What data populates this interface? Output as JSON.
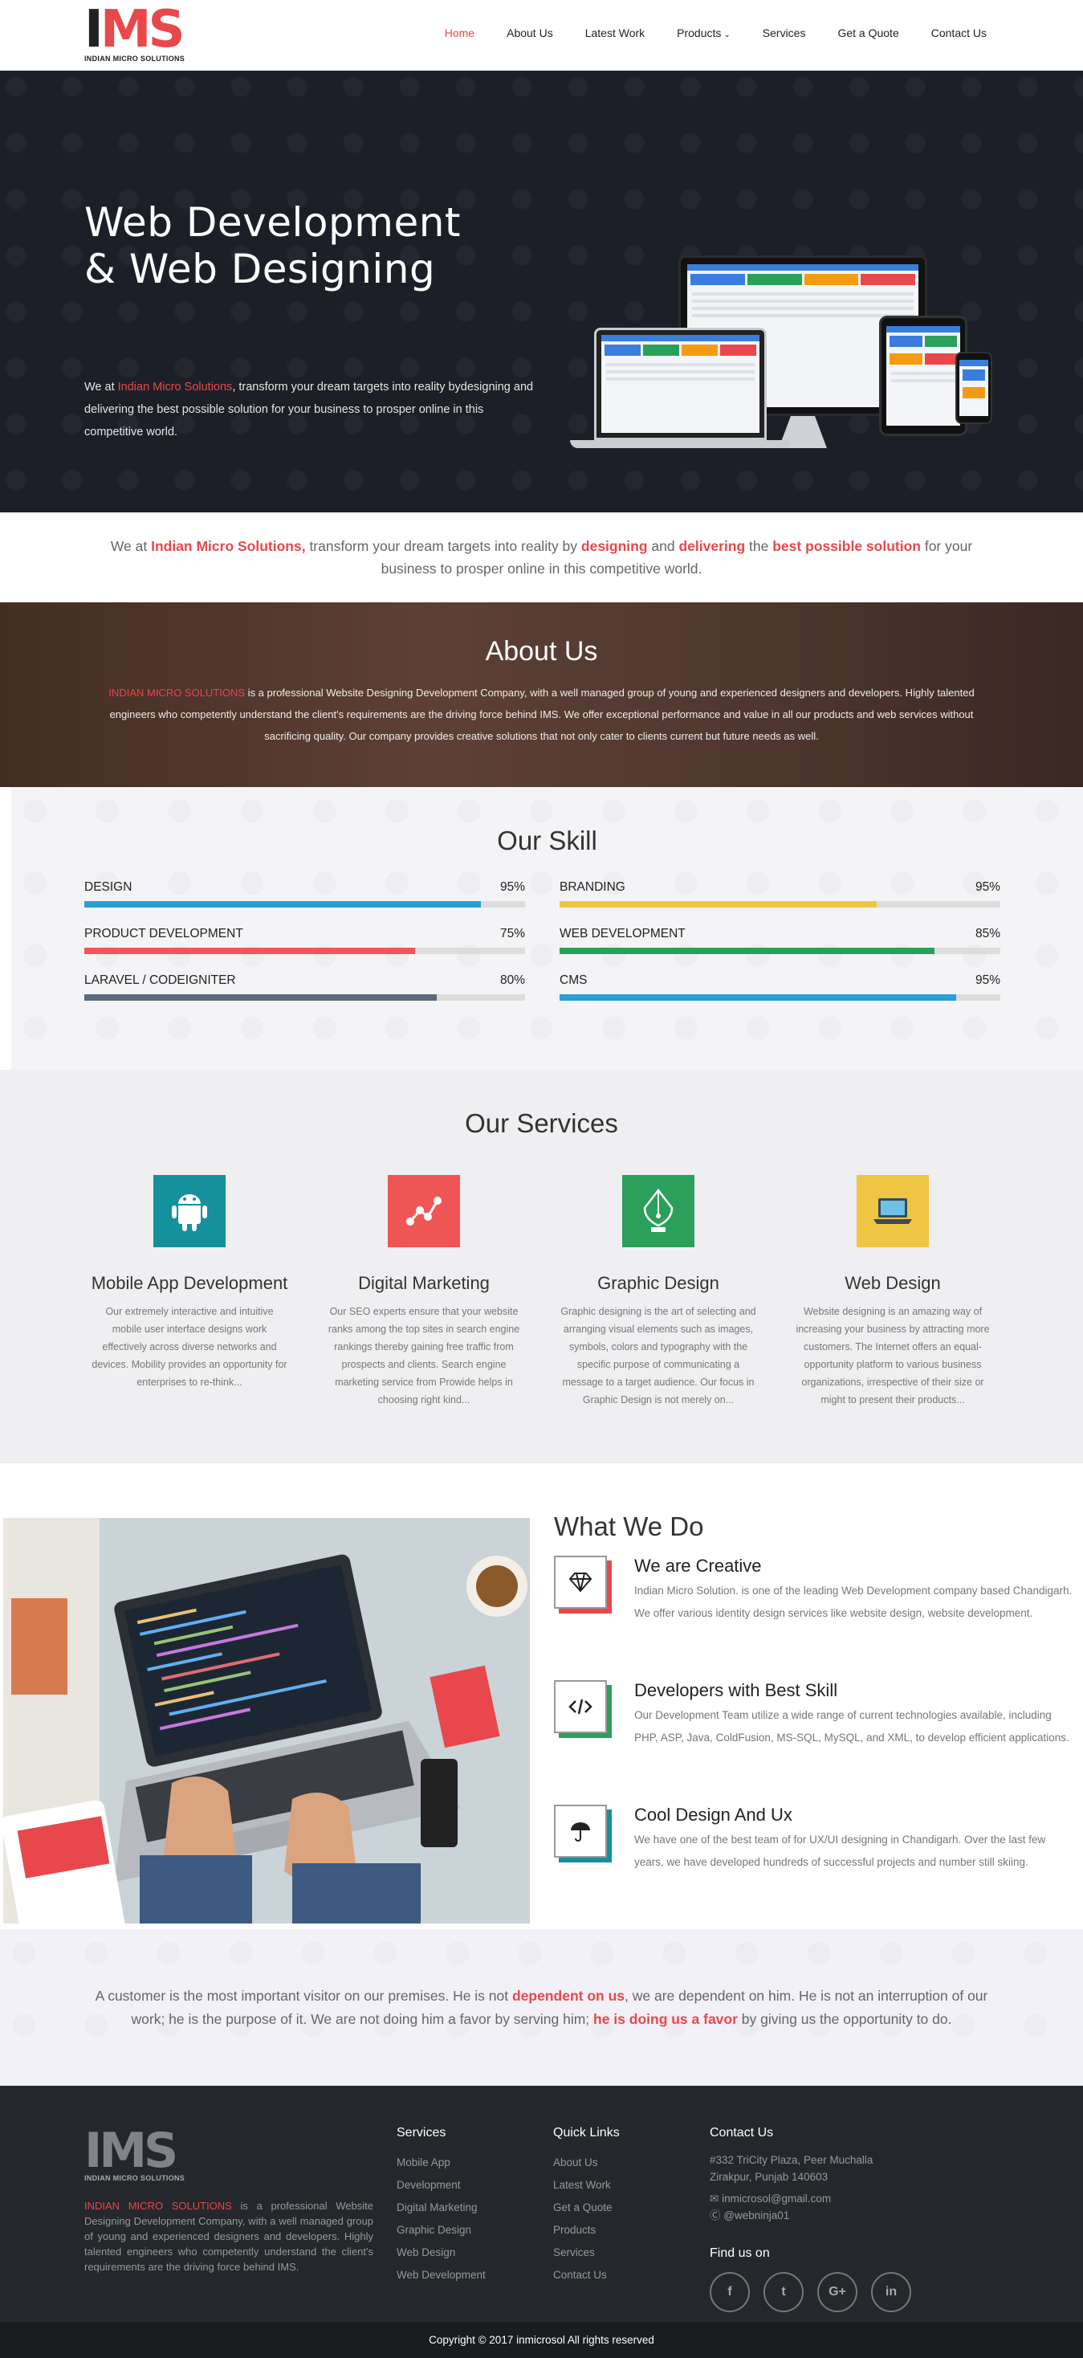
{
  "nav": {
    "logo_letters_dark": "I",
    "logo_letters_red": "MS",
    "logo_subtitle": "INDIAN MICRO SOLUTIONS",
    "items": [
      {
        "label": "Home",
        "active": true
      },
      {
        "label": "About Us"
      },
      {
        "label": "Latest Work"
      },
      {
        "label": "Products",
        "dropdown": true
      },
      {
        "label": "Services"
      },
      {
        "label": "Get a Quote"
      },
      {
        "label": "Contact Us"
      }
    ]
  },
  "hero": {
    "title_line1": "Web Development",
    "title_line2": "& Web Designing",
    "text_pre": "We at ",
    "text_highlight": "Indian Micro Solutions",
    "text_post": ", transform your dream targets into reality bydesigning and delivering the best possible solution for your business to prosper online in this competitive world."
  },
  "tagline": {
    "p1": "We at ",
    "b1": "Indian Micro Solutions,",
    "p2": " transform your dream targets into reality by ",
    "b2": "designing",
    "p3": " and ",
    "b3": "delivering",
    "p4": " the ",
    "b4": "best possible solution",
    "p5": " for your business to prosper online in this competitive world."
  },
  "about": {
    "title": "About Us",
    "highlight": "INDIAN MICRO SOLUTIONS",
    "text": " is a professional Website Designing Development Company, with a well managed group of young and experienced designers and developers. Highly talented engineers who competently understand the client's requirements are the driving force behind IMS. We offer exceptional performance and value in all our products and web services without sacrificing quality. Our company provides creative solutions that not only cater to clients current but future needs as well."
  },
  "skills": {
    "title": "Our Skill",
    "items": [
      {
        "name": "DESIGN",
        "percent_label": "95%",
        "value": 0.9,
        "color": "#2a9fd6"
      },
      {
        "name": "BRANDING",
        "percent_label": "95%",
        "value": 0.72,
        "color": "#eec643"
      },
      {
        "name": "PRODUCT DEVELOPMENT",
        "percent_label": "75%",
        "value": 0.75,
        "color": "#f05656"
      },
      {
        "name": "WEB DEVELOPMENT",
        "percent_label": "85%",
        "value": 0.85,
        "color": "#2ba05a"
      },
      {
        "name": "LARAVEL / CODEIGNITER",
        "percent_label": "80%",
        "value": 0.8,
        "color": "#5b6b7d"
      },
      {
        "name": "CMS",
        "percent_label": "95%",
        "value": 0.9,
        "color": "#2a9fd6"
      }
    ]
  },
  "services": {
    "title": "Our Services",
    "items": [
      {
        "icon": "android-icon",
        "color": "#14919b",
        "title": "Mobile App Development",
        "text": "Our extremely interactive and intuitive mobile user interface designs work effectively across diverse networks and devices. Mobility provides an opportunity for enterprises to re-think..."
      },
      {
        "icon": "analytics-icon",
        "color": "#f05656",
        "title": "Digital Marketing",
        "text": "Our SEO experts ensure that your website ranks among the top sites in search engine rankings thereby gaining free traffic from prospects and clients. Search engine marketing service from Prowide helps in choosing right kind..."
      },
      {
        "icon": "pen-nib-icon",
        "color": "#2ba05a",
        "title": "Graphic Design",
        "text": "Graphic designing is the art of selecting and arranging visual elements such as images, symbols, colors and typography with the specific purpose of communicating a message to a target audience. Our focus in Graphic Design is not merely on..."
      },
      {
        "icon": "laptop-icon",
        "color": "#eec643",
        "title": "Web Design",
        "text": "Website designing is an amazing way of increasing your business by attracting more customers. The Internet offers an equal-opportunity platform to various business organizations, irrespective of their size or might to present their products..."
      }
    ]
  },
  "what_we_do": {
    "title": "What We Do",
    "items": [
      {
        "icon": "diamond-icon",
        "accent": "#e8484b",
        "title": "We are Creative",
        "text": "Indian Micro Solution. is one of the leading Web Development company based Chandigarh. We offer various identity design services like website design, website development."
      },
      {
        "icon": "code-icon",
        "accent": "#2ba05a",
        "title": "Developers with Best Skill",
        "text": "Our Development Team utilize a wide range of current technologies available, including PHP, ASP, Java, ColdFusion, MS-SQL, MySQL, and XML, to develop efficient applications."
      },
      {
        "icon": "umbrella-icon",
        "accent": "#14919b",
        "title": "Cool Design And Ux",
        "text": "We have one of the best team of for UX/UI designing in Chandigarh. Over the last few years, we have developed hundreds of successful projects and number still skiing."
      }
    ]
  },
  "quote": {
    "p1": "A customer is the most important visitor on our premises. He is not ",
    "b1": "dependent on us",
    "p2": ", we are dependent on him. He is not an interruption of our work; he is the purpose of it. We are not doing him a favor by serving him; ",
    "b2": "he is doing us a favor",
    "p3": " by giving us the opportunity to do."
  },
  "footer": {
    "logo_letters_dark": "I",
    "logo_letters_red": "MS",
    "logo_subtitle": "INDIAN MICRO SOLUTIONS",
    "about_highlight": "INDIAN MICRO SOLUTIONS",
    "about_text": " is a professional Website Designing Development Company, with a well managed group of young and experienced designers and developers. Highly talented engineers who competently understand the client's requirements are the driving force behind IMS.",
    "services_title": "Services",
    "services": [
      "Mobile App",
      "Development",
      "Digital Marketing",
      "Graphic Design",
      "Web Design",
      "Web Development"
    ],
    "links_title": "Quick Links",
    "links": [
      "About Us",
      "Latest Work",
      "Get a Quote",
      "Products",
      "Services",
      "Contact Us"
    ],
    "contact_title": "Contact Us",
    "address_line1": "#332 TriCity Plaza, Peer Muchalla",
    "address_line2": "Zirakpur, Punjab 140603",
    "email": "inmicrosol@gmail.com",
    "skype": "@webninja01",
    "find_title": "Find us on",
    "socials": [
      {
        "icon": "facebook-icon",
        "glyph": "f"
      },
      {
        "icon": "twitter-icon",
        "glyph": "t"
      },
      {
        "icon": "google-plus-icon",
        "glyph": "G+"
      },
      {
        "icon": "linkedin-icon",
        "glyph": "in"
      }
    ],
    "copyright": "Copyright © 2017 inmicrosol All rights reserved"
  }
}
